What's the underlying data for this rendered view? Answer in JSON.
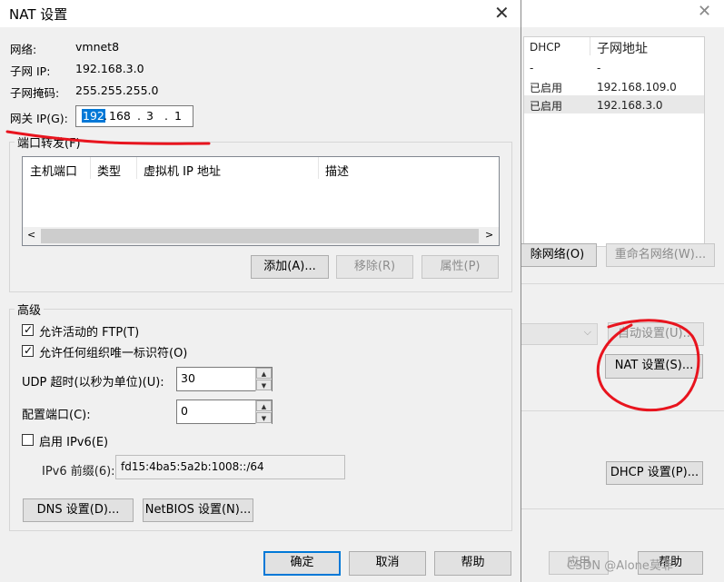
{
  "background_window": {
    "table_headers": [
      "DHCP",
      "子网地址"
    ],
    "rows": [
      {
        "dhcp": "-",
        "subnet": "-"
      },
      {
        "dhcp": "已启用",
        "subnet": "192.168.109.0"
      },
      {
        "dhcp": "已启用",
        "subnet": "192.168.3.0"
      }
    ],
    "remove_network_btn": "除网络(O)",
    "rename_network_btn": "重命名网络(W)...",
    "auto_settings_btn": "自动设置(U)...",
    "nat_settings_btn": "NAT 设置(S)...",
    "dhcp_settings_btn": "DHCP 设置(P)...",
    "apply_btn": "应用",
    "help_btn": "帮助",
    "watermark": "CSDN @Alone莫菲"
  },
  "dialog": {
    "title": "NAT 设置",
    "network_label": "网络:",
    "network_value": "vmnet8",
    "subnet_ip_label": "子网 IP:",
    "subnet_ip_value": "192.168.3.0",
    "subnet_mask_label": "子网掩码:",
    "subnet_mask_value": "255.255.255.0",
    "gateway_label": "网关 IP(G):",
    "gateway_octets": [
      "192",
      "168",
      "3",
      "1"
    ],
    "port_forward_legend": "端口转发(F)",
    "port_columns": [
      "主机端口",
      "类型",
      "虚拟机 IP 地址",
      "描述"
    ],
    "add_btn": "添加(A)...",
    "remove_btn": "移除(R)",
    "properties_btn": "属性(P)",
    "advanced_legend": "高级",
    "allow_ftp": "允许活动的 FTP(T)",
    "allow_ftp_checked": true,
    "allow_oui": "允许任何组织唯一标识符(O)",
    "allow_oui_checked": true,
    "udp_label": "UDP 超时(以秒为单位)(U):",
    "udp_value": "30",
    "config_port_label": "配置端口(C):",
    "config_port_value": "0",
    "ipv6_enable": "启用 IPv6(E)",
    "ipv6_checked": false,
    "ipv6_prefix_label": "IPv6 前缀(6):",
    "ipv6_prefix_value": "fd15:4ba5:5a2b:1008::/64",
    "dns_btn": "DNS 设置(D)...",
    "netbios_btn": "NetBIOS 设置(N)...",
    "ok_btn": "确定",
    "cancel_btn": "取消",
    "help_btn": "帮助"
  },
  "annotation_color": "#e8141e"
}
